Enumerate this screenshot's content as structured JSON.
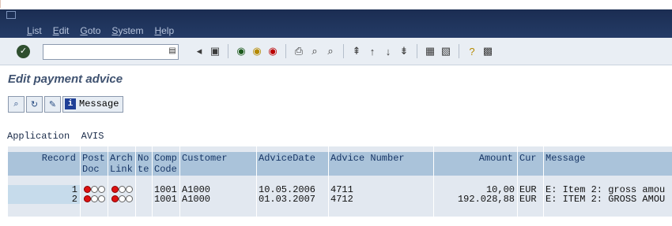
{
  "menubar": {
    "items": [
      "List",
      "Edit",
      "Goto",
      "System",
      "Help"
    ]
  },
  "toolbar": {
    "command_value": ""
  },
  "page": {
    "title": "Edit payment advice"
  },
  "app_toolbar": {
    "message_label": "Message"
  },
  "application": {
    "label": "Application",
    "value": "AVIS"
  },
  "table": {
    "headers": {
      "record": [
        "Record",
        ""
      ],
      "post_doc": [
        "Post",
        "Doc"
      ],
      "arch_link": [
        "Arch",
        "Link"
      ],
      "note": [
        "No",
        "te"
      ],
      "comp_code": [
        "Comp",
        "Code"
      ],
      "customer": [
        "Customer",
        ""
      ],
      "advice_date": [
        "AdviceDate",
        ""
      ],
      "advice_number": [
        "Advice Number",
        ""
      ],
      "amount": [
        "Amount",
        ""
      ],
      "currency": [
        "Cur",
        ""
      ],
      "message": [
        "Message",
        ""
      ]
    },
    "rows": [
      {
        "record": "1",
        "note": "",
        "comp_code": "1001",
        "customer": "A1000",
        "advice_date": "10.05.2006",
        "advice_number": "4711",
        "amount": "10,00",
        "currency": "EUR",
        "message": "E: Item 2: gross amou"
      },
      {
        "record": "2",
        "note": "",
        "comp_code": "1001",
        "customer": "A1000",
        "advice_date": "01.03.2007",
        "advice_number": "4712",
        "amount": "192.028,88",
        "currency": "EUR",
        "message": "E: ITEM 2: GROSS AMOU"
      }
    ]
  },
  "colors": {
    "menubar": "#1b2d52",
    "header": "#aac3da",
    "title": "#3f5270",
    "traffic_red": "#dd1111"
  }
}
